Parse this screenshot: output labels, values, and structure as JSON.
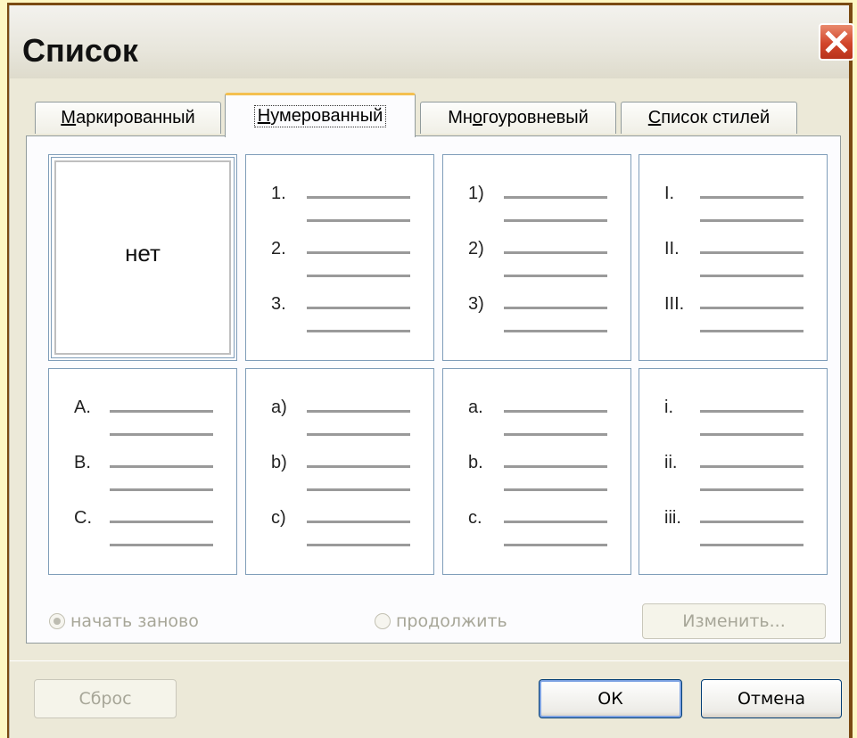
{
  "window": {
    "title": "Список",
    "close_icon": "close-icon"
  },
  "tabs": [
    {
      "prefix": "",
      "key": "М",
      "rest": "аркированный"
    },
    {
      "prefix": "",
      "key": "Н",
      "rest": "умерованный"
    },
    {
      "prefix": "Мн",
      "key": "о",
      "rest": "гоуровневый"
    },
    {
      "prefix": "",
      "key": "С",
      "rest": "писок стилей"
    }
  ],
  "active_tab": 1,
  "gallery": {
    "none_label": "нет",
    "styles": [
      [
        "1.",
        "2.",
        "3."
      ],
      [
        "1)",
        "2)",
        "3)"
      ],
      [
        "I.",
        "II.",
        "III."
      ],
      [
        "A.",
        "B.",
        "C."
      ],
      [
        "a)",
        "b)",
        "c)"
      ],
      [
        "a.",
        "b.",
        "c."
      ],
      [
        "i.",
        "ii.",
        "iii."
      ]
    ]
  },
  "options": {
    "restart_label": "начать заново",
    "continue_label": "продолжить",
    "restart_selected": true,
    "modify_button": "Изменить..."
  },
  "footer": {
    "reset_button": "Сброс",
    "ok_button": "ОК",
    "cancel_button": "Отмена"
  },
  "colors": {
    "accent_tab": "#f4c050",
    "close": "#d2452a",
    "background": "#fdf7c3"
  }
}
